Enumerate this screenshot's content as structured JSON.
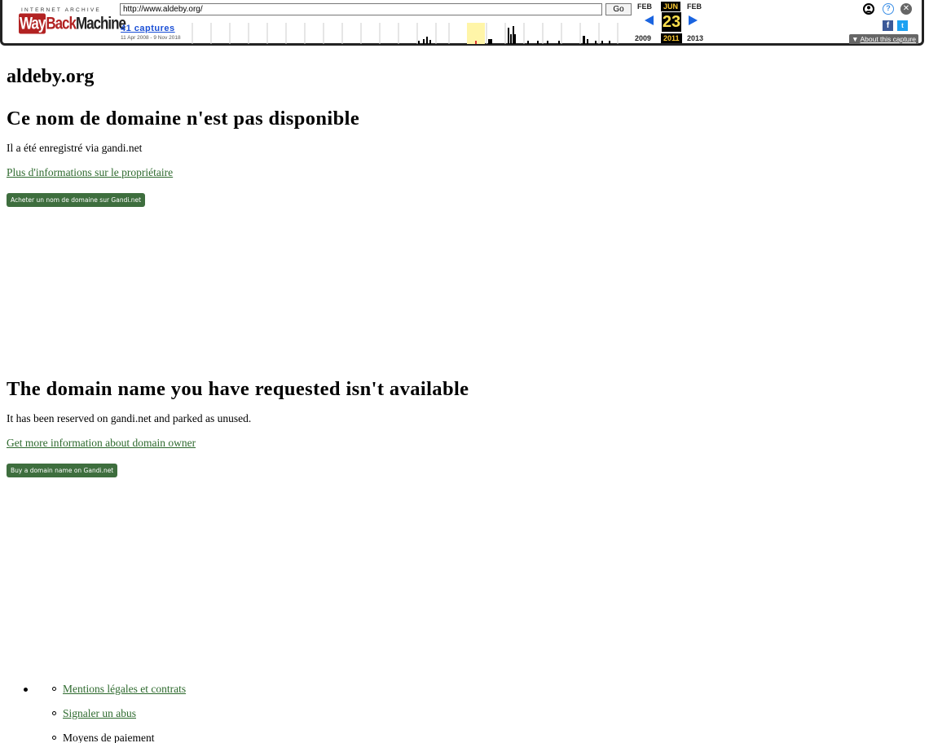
{
  "wayback": {
    "logo_top": "INTERNET ARCHIVE",
    "logo_way": "Way",
    "logo_back": "Back",
    "logo_machine": "Machine",
    "url": "http://www.aldeby.org/",
    "go_label": "Go",
    "captures_label": "41 captures",
    "date_range": "11 Apr 2008 - 9 Nov 2018",
    "prev_month": "FEB",
    "cur_month": "JUN",
    "next_month": "FEB",
    "cur_day": "23",
    "prev_year": "2009",
    "cur_year": "2011",
    "next_year": "2013",
    "help_glyph": "?",
    "close_glyph": "✕",
    "facebook_glyph": "f",
    "twitter_glyph": "t",
    "about_arrow": "▼",
    "about_label": "About this capture"
  },
  "page": {
    "site_title": "aldeby.org",
    "fr": {
      "heading": "Ce nom de domaine n'est pas disponible",
      "text": "Il a été enregistré via gandi.net",
      "link": "Plus d'informations sur le propriétaire",
      "button": "Acheter un nom de domaine sur Gandi.net"
    },
    "en": {
      "heading": "The domain name you have requested isn't available",
      "text": "It has been reserved on gandi.net and parked as unused.",
      "link": "Get more information about domain owner",
      "button": "Buy a domain name on Gandi.net"
    },
    "footer": {
      "items": [
        {
          "label": "Mentions légales et contrats",
          "is_link": true
        },
        {
          "label": "Signaler un abus",
          "is_link": true
        },
        {
          "label": "Moyens de paiement",
          "is_link": false
        }
      ]
    }
  },
  "colors": {
    "link_green": "#2e6a2e",
    "button_green": "#3e6e3e",
    "wayback_blue": "#1a4fd6",
    "highlight_yellow": "#ffe04d"
  }
}
